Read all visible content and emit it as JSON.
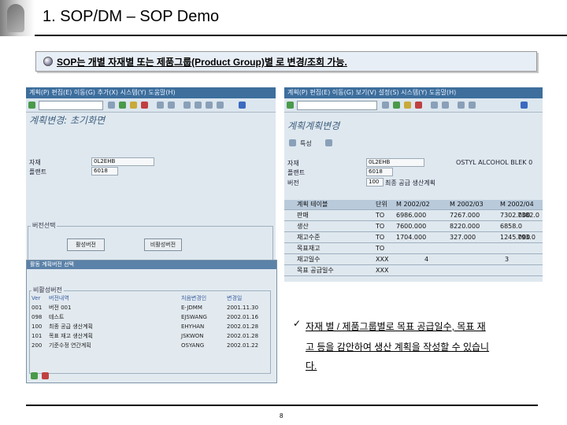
{
  "slide": {
    "title": "1. SOP/DM – SOP Demo",
    "bullet": "SOP는 개별 자재별 또는 제품그룹(Product Group)별 로 변경/조회 가능.",
    "note_lines": [
      "자재 별 / 제품그룹별로 목표 공급일수, 목표 재",
      "고 등을 감안하여 생산 계획을 작성할 수 있습니",
      "다."
    ],
    "page_number": "8"
  },
  "left_window": {
    "menu": "계획(P)  편집(E)  이동(G)  추가(X)  시스템(Y)  도움말(H)",
    "screen_title": "계획변경: 초기화면",
    "fields": [
      {
        "label": "자재",
        "value": "0L2EHB"
      },
      {
        "label": "플랜트",
        "value": "6018"
      }
    ],
    "group_title": "버전선택",
    "buttons": [
      "활성버전",
      "비활성버전"
    ]
  },
  "dialog": {
    "caption": "활동 계획버전 선택",
    "list_title": "비활성버전",
    "headers": [
      "Ver",
      "버전내역",
      "처음변경인",
      "변경일"
    ],
    "rows": [
      [
        "001",
        "버전 001",
        "E-JDMM",
        "2001.11.30"
      ],
      [
        "098",
        "테스트",
        "EJSWANG",
        "2002.01.16"
      ],
      [
        "100",
        "최종 공급 생산계획",
        "EHYHAN",
        "2002.01.28"
      ],
      [
        "101",
        "목표 재고 생산계획",
        "JSKWON",
        "2002.01.28"
      ],
      [
        "200",
        "기준수정 연간계획",
        "OSYANG",
        "2002.01.22"
      ]
    ]
  },
  "right_window": {
    "menu": "계획(P)  편집(E)  이동(G)  보기(V)  설정(S)  시스템(Y)  도움말(H)",
    "screen_title": "계획계획변경",
    "tab_label": "특성",
    "header_rows": [
      {
        "label": "자재",
        "value": "0L2EHB",
        "extra": "OSTYL ALCOHOL BLEK 0"
      },
      {
        "label": "플랜트",
        "value": "6018",
        "extra": ""
      },
      {
        "label": "버전",
        "value": "100",
        "extra": "최종 공급 생산계획"
      }
    ],
    "table_headers": [
      "계획 테이블",
      "단위",
      "M 2002/02",
      "M 2002/03",
      "M 2002/04"
    ],
    "table_rows": [
      [
        "판매",
        "TO",
        "6986.000",
        "7267.000",
        "7302.000",
        "7382.0"
      ],
      [
        "생산",
        "TO",
        "7600.000",
        "8220.000",
        "6858.0"
      ],
      [
        "재고수준",
        "TO",
        "1704.000",
        "327.000",
        "1245.000",
        "793.0"
      ],
      [
        "목표재고",
        "TO"
      ],
      [
        "재고일수",
        "XXX",
        "4",
        "3"
      ],
      [
        "목표 공급일수",
        "XXX"
      ]
    ]
  }
}
